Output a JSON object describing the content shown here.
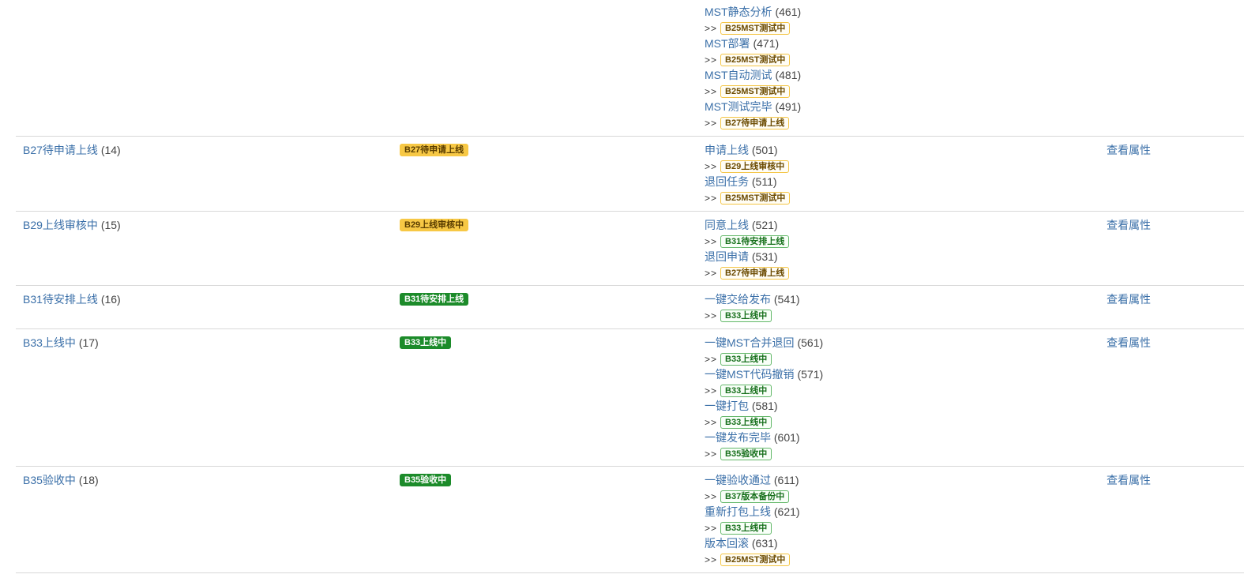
{
  "colors": {
    "link": "#3a6fa8",
    "warn": "#f7c845",
    "success": "#1c8b2a"
  },
  "rows": [
    {
      "transitions": [
        {
          "name": "MST静态分析",
          "count": "(461)",
          "target": "B25MST测试中"
        },
        {
          "name": "MST部署",
          "count": "(471)",
          "target": "B25MST测试中"
        },
        {
          "name": "MST自动测试",
          "count": "(481)",
          "target": "B25MST测试中"
        },
        {
          "name": "MST测试完毕",
          "count": "(491)",
          "target": "B27待申请上线"
        }
      ]
    },
    {
      "state": "B27待申请上线",
      "count": "(14)",
      "badge": "B27待申请上线",
      "action": "查看属性",
      "transitions": [
        {
          "name": "申请上线",
          "count": "(501)",
          "target": "B29上线审核中"
        },
        {
          "name": "退回任务",
          "count": "(511)",
          "target": "B25MST测试中"
        }
      ]
    },
    {
      "state": "B29上线审核中",
      "count": "(15)",
      "badge": "B29上线审核中",
      "action": "查看属性",
      "transitions": [
        {
          "name": "同意上线",
          "count": "(521)",
          "target": "B31待安排上线"
        },
        {
          "name": "退回申请",
          "count": "(531)",
          "target": "B27待申请上线"
        }
      ]
    },
    {
      "state": "B31待安排上线",
      "count": "(16)",
      "badge": "B31待安排上线",
      "action": "查看属性",
      "transitions": [
        {
          "name": "一键交给发布",
          "count": "(541)",
          "target": "B33上线中"
        }
      ]
    },
    {
      "state": "B33上线中",
      "count": "(17)",
      "badge": "B33上线中",
      "action": "查看属性",
      "transitions": [
        {
          "name": "一键MST合并退回",
          "count": "(561)",
          "target": "B33上线中"
        },
        {
          "name": "一键MST代码撤销",
          "count": "(571)",
          "target": "B33上线中"
        },
        {
          "name": "一键打包",
          "count": "(581)",
          "target": "B33上线中"
        },
        {
          "name": "一键发布完毕",
          "count": "(601)",
          "target": "B35验收中"
        }
      ]
    },
    {
      "state": "B35验收中",
      "count": "(18)",
      "badge": "B35验收中",
      "action": "查看属性",
      "transitions": [
        {
          "name": "一键验收通过",
          "count": "(611)",
          "target": "B37版本备份中"
        },
        {
          "name": "重新打包上线",
          "count": "(621)",
          "target": "B33上线中"
        },
        {
          "name": "版本回滚",
          "count": "(631)",
          "target": "B25MST测试中"
        }
      ]
    }
  ],
  "arrow_text": ">>"
}
